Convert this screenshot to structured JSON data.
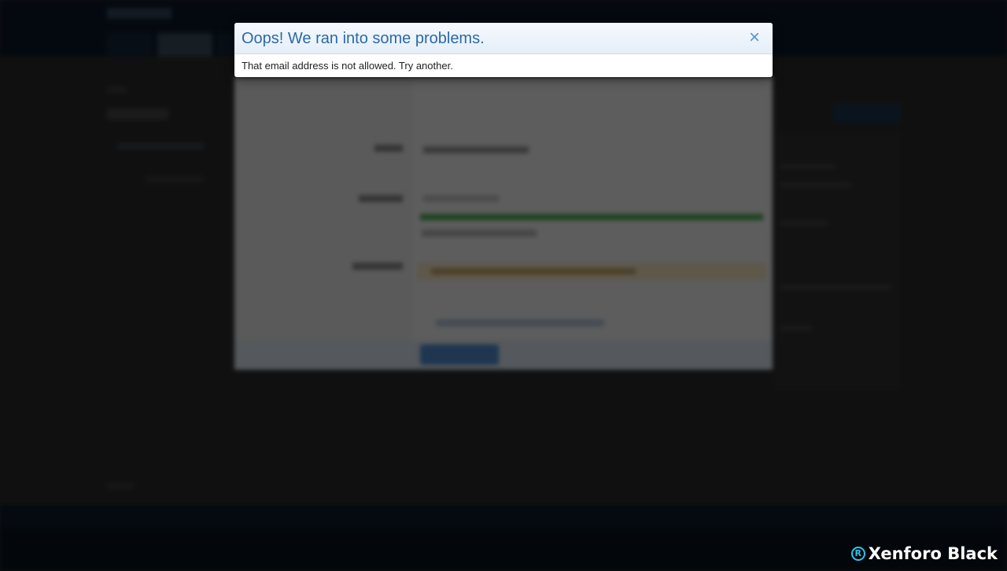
{
  "dialog": {
    "title": "Oops! We ran into some problems.",
    "close_icon": "×",
    "message": "That email address is not allowed. Try another."
  },
  "brand": {
    "mark": "R",
    "name": "Xenforo Black"
  }
}
